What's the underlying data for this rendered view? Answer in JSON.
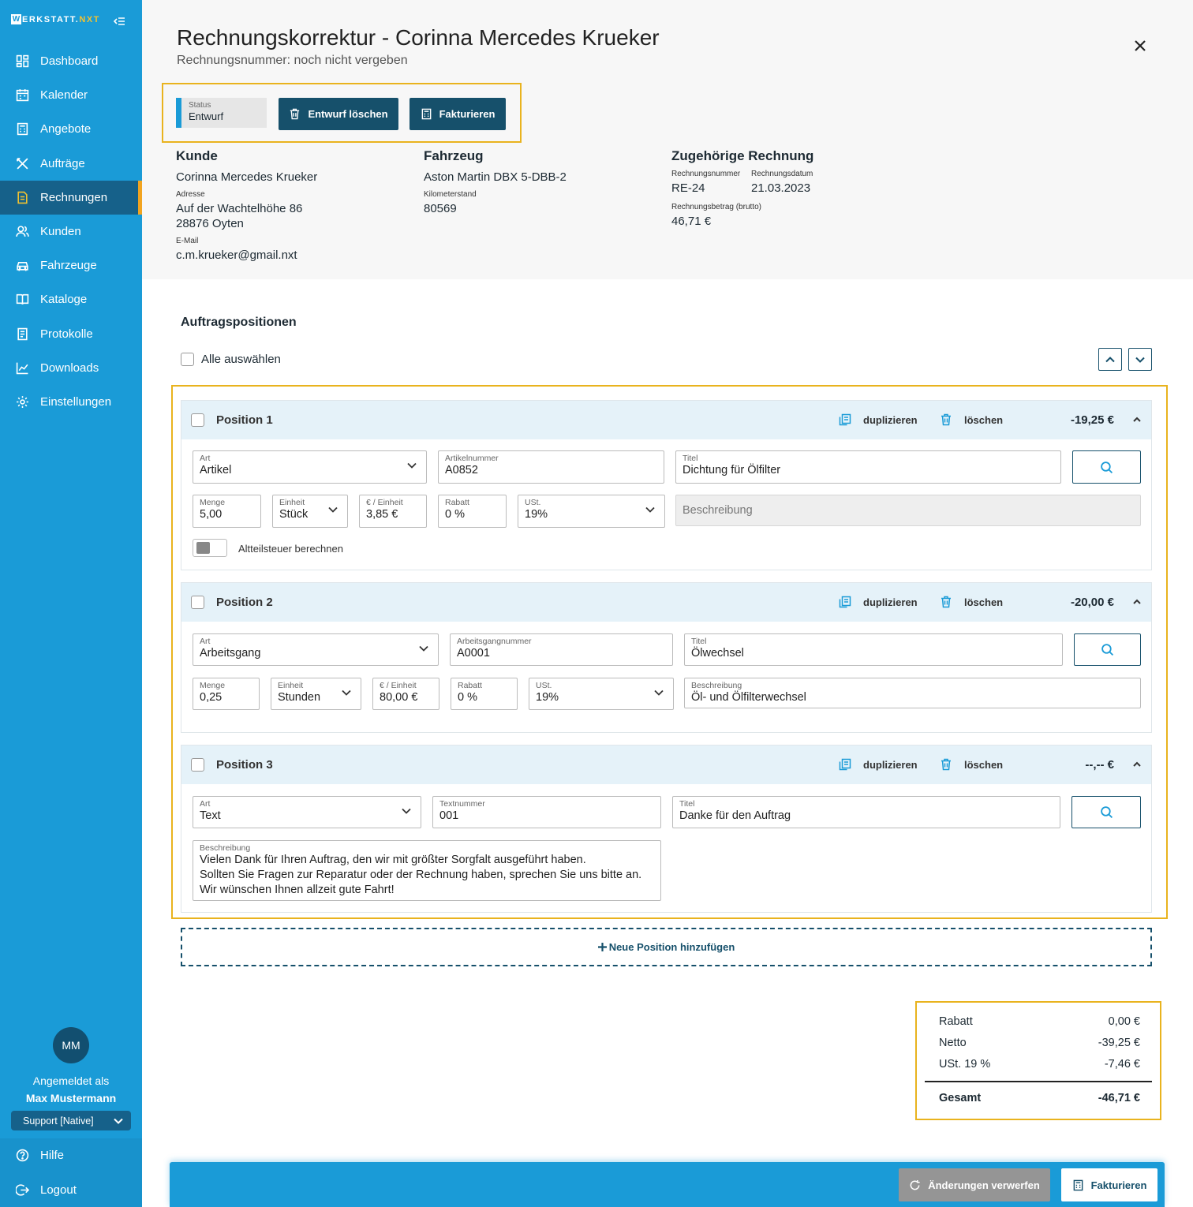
{
  "app": {
    "logo_w": "W",
    "logo_rest": "ERKSTATT.",
    "logo_nxt": "NXT"
  },
  "sidebar": {
    "items": [
      {
        "label": "Dashboard",
        "icon": "dashboard-icon"
      },
      {
        "label": "Kalender",
        "icon": "calendar-icon"
      },
      {
        "label": "Angebote",
        "icon": "calculator-icon"
      },
      {
        "label": "Aufträge",
        "icon": "tools-icon"
      },
      {
        "label": "Rechnungen",
        "icon": "invoice-icon",
        "active": true
      },
      {
        "label": "Kunden",
        "icon": "users-icon"
      },
      {
        "label": "Fahrzeuge",
        "icon": "car-icon"
      },
      {
        "label": "Kataloge",
        "icon": "book-icon"
      },
      {
        "label": "Protokolle",
        "icon": "document-icon"
      },
      {
        "label": "Downloads",
        "icon": "chart-icon"
      },
      {
        "label": "Einstellungen",
        "icon": "gear-icon"
      }
    ],
    "user": {
      "initials": "MM",
      "logged_in_label": "Angemeldet als",
      "name": "Max Mustermann",
      "role": "Support [Native]"
    },
    "bottom": [
      {
        "label": "Hilfe",
        "icon": "help-icon"
      },
      {
        "label": "Logout",
        "icon": "logout-icon"
      }
    ]
  },
  "header": {
    "title": "Rechnungskorrektur - Corinna Mercedes Krueker",
    "subtitle": "Rechnungsnummer: noch nicht vergeben",
    "status_label": "Status",
    "status_value": "Entwurf",
    "delete_draft": "Entwurf löschen",
    "invoice_btn": "Fakturieren"
  },
  "customer": {
    "heading": "Kunde",
    "name": "Corinna Mercedes Krueker",
    "address_label": "Adresse",
    "street": "Auf der Wachtelhöhe 86",
    "city": "28876 Oyten",
    "email_label": "E-Mail",
    "email": "c.m.krueker@gmail.nxt"
  },
  "vehicle": {
    "heading": "Fahrzeug",
    "name": "Aston Martin DBX 5-DBB-2",
    "km_label": "Kilometerstand",
    "km": "80569"
  },
  "related_invoice": {
    "heading": "Zugehörige Rechnung",
    "number_label": "Rechnungsnummer",
    "number": "RE-24",
    "date_label": "Rechnungsdatum",
    "date": "21.03.2023",
    "amount_label": "Rechnungsbetrag (brutto)",
    "amount": "46,71 €"
  },
  "positions_section": {
    "title": "Auftragspositionen",
    "select_all": "Alle auswählen",
    "duplicate": "duplizieren",
    "delete": "löschen",
    "add": "Neue Position hinzufügen"
  },
  "positions": [
    {
      "title": "Position 1",
      "amount": "-19,25 €",
      "art_label": "Art",
      "art": "Artikel",
      "num_label": "Artikelnummer",
      "num": "A0852",
      "titel_label": "Titel",
      "titel": "Dichtung für Ölfilter",
      "menge_label": "Menge",
      "menge": "5,00",
      "einheit_label": "Einheit",
      "einheit": "Stück",
      "preis_label": "€ / Einheit",
      "preis": "3,85 €",
      "rabatt_label": "Rabatt",
      "rabatt": "0 %",
      "ust_label": "USt.",
      "ust": "19%",
      "beschreibung_placeholder": "Beschreibung",
      "toggle_label": "Altteilsteuer berechnen"
    },
    {
      "title": "Position 2",
      "amount": "-20,00 €",
      "art_label": "Art",
      "art": "Arbeitsgang",
      "num_label": "Arbeitsgangnummer",
      "num": "A0001",
      "titel_label": "Titel",
      "titel": "Ölwechsel",
      "menge_label": "Menge",
      "menge": "0,25",
      "einheit_label": "Einheit",
      "einheit": "Stunden",
      "preis_label": "€ / Einheit",
      "preis": "80,00 €",
      "rabatt_label": "Rabatt",
      "rabatt": "0 %",
      "ust_label": "USt.",
      "ust": "19%",
      "beschreibung_label": "Beschreibung",
      "beschreibung": "Öl- und Ölfilterwechsel"
    },
    {
      "title": "Position 3",
      "amount": "--,-- €",
      "art_label": "Art",
      "art": "Text",
      "num_label": "Textnummer",
      "num": "001",
      "titel_label": "Titel",
      "titel": "Danke für den Auftrag",
      "beschreibung_label": "Beschreibung",
      "beschreibung_lines": [
        "Vielen Dank für Ihren Auftrag, den wir mit größter Sorgfalt ausgeführt haben.",
        "Sollten Sie Fragen zur Reparatur oder der Rechnung haben, sprechen Sie uns bitte an.",
        "Wir wünschen Ihnen allzeit gute Fahrt!"
      ]
    }
  ],
  "totals": {
    "rabatt_label": "Rabatt",
    "rabatt": "0,00 €",
    "netto_label": "Netto",
    "netto": "-39,25 €",
    "ust_label": "USt. 19 %",
    "ust": "-7,46 €",
    "gesamt_label": "Gesamt",
    "gesamt": "-46,71 €"
  },
  "footer": {
    "discard": "Änderungen verwerfen",
    "invoice": "Fakturieren"
  },
  "colors": {
    "sidebar": "#1a9bd7",
    "sidebar_active": "#16618a",
    "primary_dark": "#16506b",
    "highlight_frame": "#e9b31e",
    "logo_accent": "#f2c230"
  }
}
